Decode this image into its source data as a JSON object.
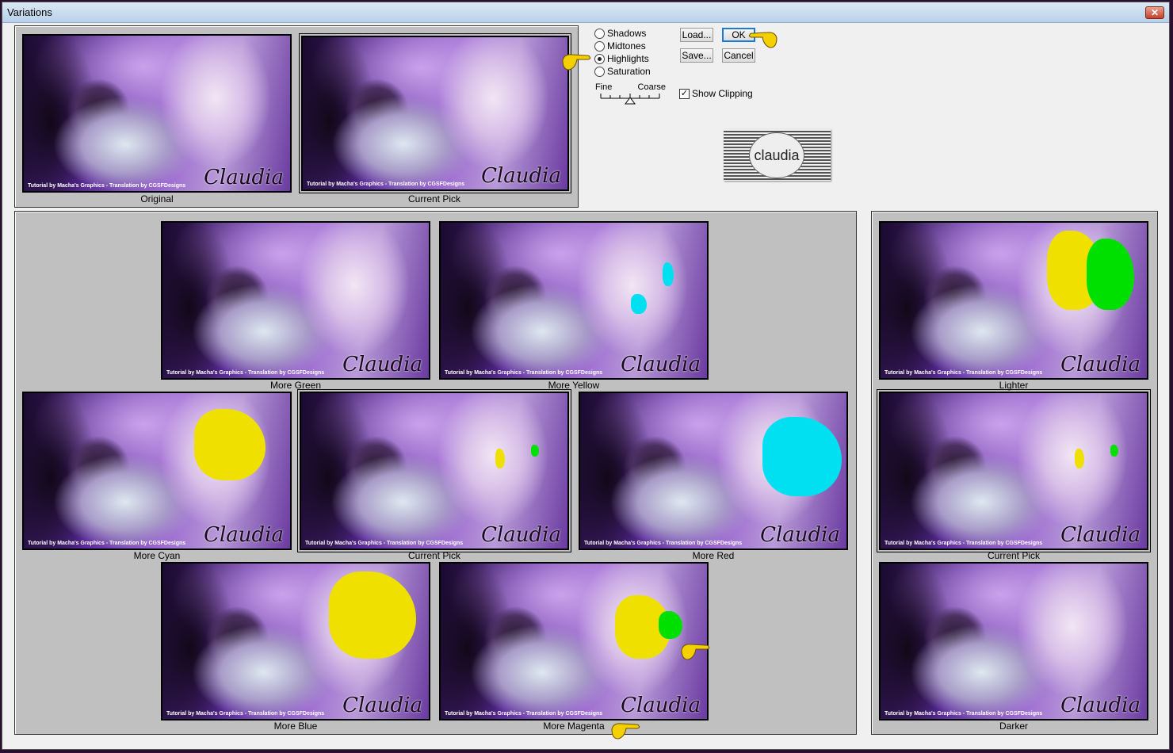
{
  "window": {
    "title": "Variations",
    "close": "✕"
  },
  "thumb_caption": "Tutorial by Macha's Graphics - Translation by CGSFDesigns",
  "watermark": "Claudia",
  "top": {
    "original": "Original",
    "current_pick": "Current Pick"
  },
  "modes": {
    "items": [
      {
        "label": "Shadows",
        "selected": false
      },
      {
        "label": "Midtones",
        "selected": false
      },
      {
        "label": "Highlights",
        "selected": true
      },
      {
        "label": "Saturation",
        "selected": false
      }
    ]
  },
  "buttons": {
    "load": "Load...",
    "ok": "OK",
    "save": "Save...",
    "cancel": "Cancel"
  },
  "slider": {
    "min_label": "Fine",
    "max_label": "Coarse",
    "position": 0.5
  },
  "show_clipping": {
    "label": "Show Clipping",
    "checked": true
  },
  "logo_text": "claudia",
  "variations": {
    "more_green": "More Green",
    "more_yellow": "More Yellow",
    "more_cyan": "More Cyan",
    "current_pick": "Current Pick",
    "more_red": "More Red",
    "more_blue": "More Blue",
    "more_magenta": "More Magenta"
  },
  "brightness": {
    "lighter": "Lighter",
    "current_pick": "Current Pick",
    "darker": "Darker"
  },
  "clip_colors": {
    "yellow": "#f0e000",
    "green": "#00e000",
    "cyan": "#00e0f0"
  }
}
